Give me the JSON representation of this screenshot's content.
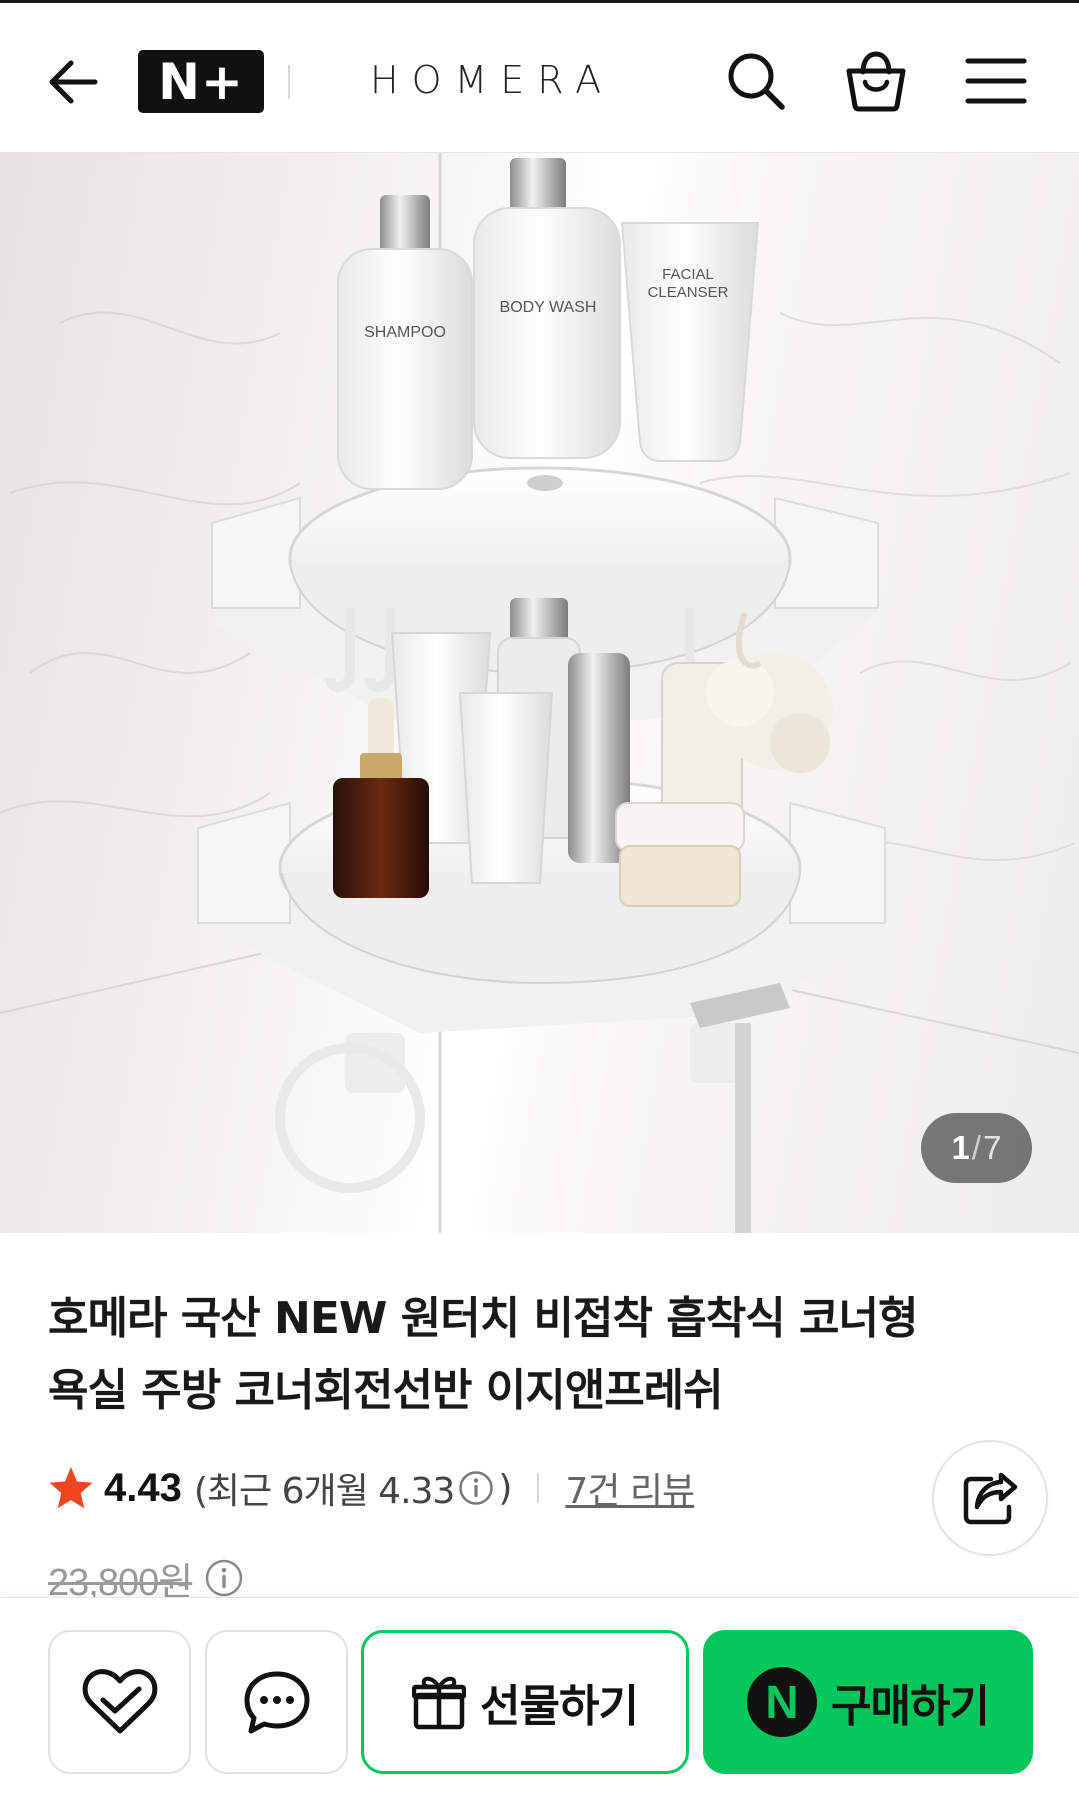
{
  "header": {
    "logo_text": "N+",
    "brand": "HOMERA",
    "icons": [
      "back-arrow-icon",
      "search-icon",
      "shopping-bag-icon",
      "hamburger-menu-icon"
    ]
  },
  "image_viewer": {
    "current": "1",
    "separator": "/",
    "total": "7",
    "product_labels": {
      "bottle_left": "SHAMPOO",
      "bottle_middle": "BODY WASH",
      "tube_right_line1": "FACIAL",
      "tube_right_line2": "CLEANSER"
    }
  },
  "product": {
    "title_line1": "호메라 국산 NEW 원터치 비접착 흡착식 코너형",
    "title_line2": "욕실 주방 코너회전선반 이지앤프레쉬",
    "rating": "4.43",
    "recent_prefix": "(최근 6개월 4.33",
    "recent_suffix": ")",
    "review_link": "7건 리뷰",
    "original_price": "23,800원"
  },
  "bottom_bar": {
    "gift_label": "선물하기",
    "buy_badge": "N",
    "buy_label": "구매하기"
  },
  "colors": {
    "accent_green": "#03c75a",
    "star_red": "#f0451e",
    "text_dark": "#111111"
  }
}
